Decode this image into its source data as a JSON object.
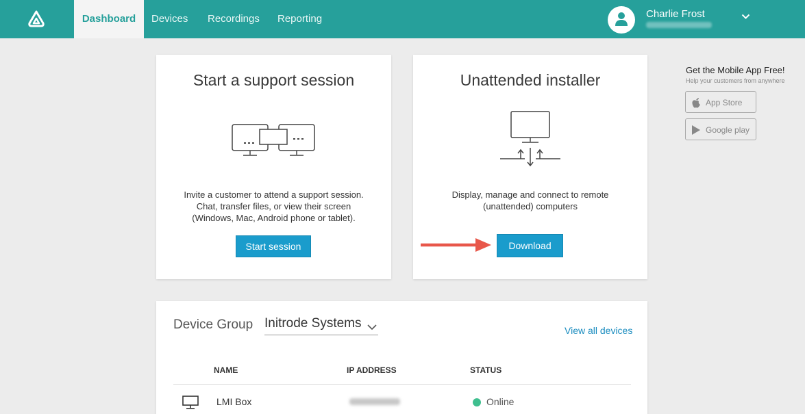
{
  "nav": {
    "tabs": [
      {
        "label": "Dashboard"
      },
      {
        "label": "Devices"
      },
      {
        "label": "Recordings"
      },
      {
        "label": "Reporting"
      }
    ],
    "active_tab": "Dashboard"
  },
  "user": {
    "name": "Charlie Frost",
    "avatar_icon": "user-icon",
    "menu_icon": "chevron-down-icon"
  },
  "support_card": {
    "title": "Start a support session",
    "description_lines": [
      "Invite a customer to attend a support session.",
      "Chat, transfer files, or view their screen",
      "(Windows, Mac, Android phone or tablet)."
    ],
    "button_label": "Start session",
    "illustration_icon": "screen-sharing-icon"
  },
  "installer_card": {
    "title": "Unattended installer",
    "description_lines": [
      "Display, manage and connect to remote",
      "(unattended) computers"
    ],
    "button_label": "Download",
    "illustration_icon": "network-computer-icon",
    "annotation_icon": "red-arrow-icon"
  },
  "mobile_app": {
    "title": "Get the Mobile App Free!",
    "subtitle": "Help your customers from anywhere",
    "app_store_label": "App Store",
    "google_play_label": "Google play"
  },
  "devices": {
    "group_label": "Device Group",
    "group_value": "Initrode Systems",
    "view_all_label": "View all devices",
    "columns": [
      "NAME",
      "IP ADDRESS",
      "STATUS"
    ],
    "rows": [
      {
        "name": "LMI Box",
        "status": "Online",
        "icon": "monitor-icon"
      }
    ]
  },
  "colors": {
    "topbar": "#26a09b",
    "button": "#1a9ccc",
    "link": "#1a8cbf",
    "online": "#3fbf8f",
    "annotation": "#e8574a"
  }
}
